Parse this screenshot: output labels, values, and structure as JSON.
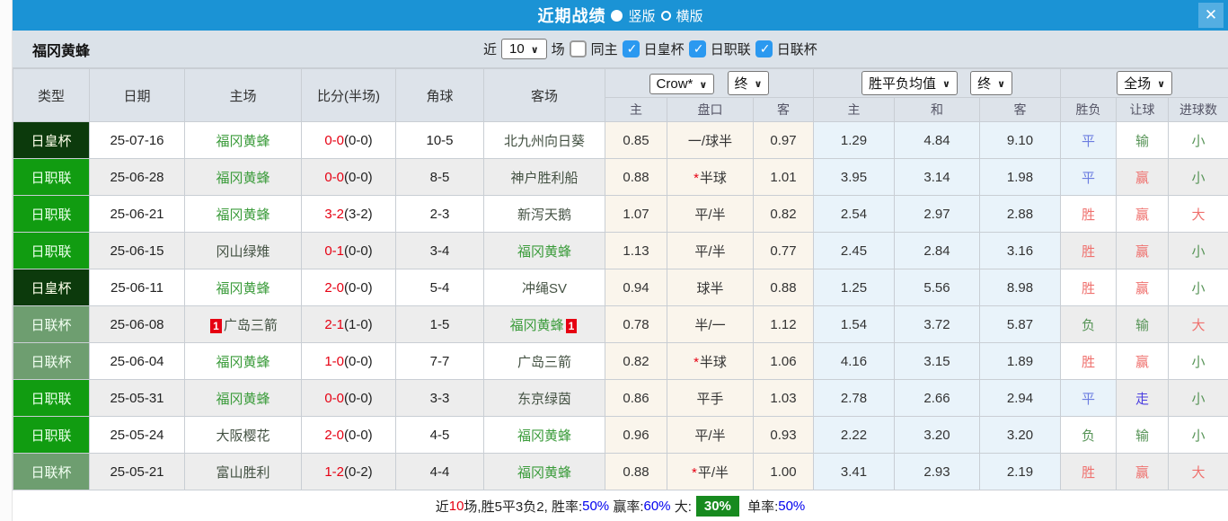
{
  "titlebar": {
    "title": "近期战绩",
    "vertical_label": "竖版",
    "horizontal_label": "横版",
    "vertical_selected": true,
    "close_icon": "✕"
  },
  "filter": {
    "team": "福冈黄蜂",
    "recent_label": "近",
    "count": "10",
    "matches_label": "场",
    "same_home_label": "同主",
    "same_home_checked": false,
    "leagues": [
      {
        "label": "日皇杯",
        "checked": true
      },
      {
        "label": "日职联",
        "checked": true
      },
      {
        "label": "日联杯",
        "checked": true
      }
    ]
  },
  "controls": {
    "bookmaker": "Crow*",
    "handicap_time": "终",
    "avg_label": "胜平负均值",
    "odds_time": "终",
    "scope": "全场"
  },
  "header": {
    "main": [
      "类型",
      "日期",
      "主场",
      "比分(半场)",
      "角球",
      "客场"
    ],
    "sub": [
      "主",
      "盘口",
      "客",
      "主",
      "和",
      "客",
      "胜负",
      "让球",
      "进球数"
    ]
  },
  "colors": {
    "titlebar_blue": "#1b93d5",
    "cup_green": "#0c3a0c",
    "league_green": "#119c11",
    "league_cup_green": "#6e9e70",
    "self_team_green": "#3a9b3a",
    "score_red": "#e60012",
    "result_red": "#ef716e",
    "result_blue": "#6b7ce0",
    "result_green": "#579457",
    "badge_green": "#178a1f"
  },
  "rows": [
    {
      "type": "日皇杯",
      "type_style": "cup",
      "date": "25-07-16",
      "home": "福冈黄蜂",
      "home_self": true,
      "home_card": "",
      "score": "0-0",
      "half": "(0-0)",
      "corner": "10-5",
      "away": "北九州向日葵",
      "away_self": false,
      "away_card": "",
      "h_home": "0.85",
      "h_star": false,
      "h_line": "一/球半",
      "h_away": "0.97",
      "o_home": "1.29",
      "o_draw": "4.84",
      "o_away": "9.10",
      "r_wdl": "平",
      "r_wdl_c": "blue",
      "r_handicap": "输",
      "r_handicap_c": "green",
      "r_goals": "小",
      "r_goals_c": "green"
    },
    {
      "type": "日职联",
      "type_style": "league",
      "date": "25-06-28",
      "home": "福冈黄蜂",
      "home_self": true,
      "home_card": "",
      "score": "0-0",
      "half": "(0-0)",
      "corner": "8-5",
      "away": "神户胜利船",
      "away_self": false,
      "away_card": "",
      "h_home": "0.88",
      "h_star": true,
      "h_line": "半球",
      "h_away": "1.01",
      "o_home": "3.95",
      "o_draw": "3.14",
      "o_away": "1.98",
      "r_wdl": "平",
      "r_wdl_c": "blue",
      "r_handicap": "赢",
      "r_handicap_c": "red",
      "r_goals": "小",
      "r_goals_c": "green"
    },
    {
      "type": "日职联",
      "type_style": "league",
      "date": "25-06-21",
      "home": "福冈黄蜂",
      "home_self": true,
      "home_card": "",
      "score": "3-2",
      "half": "(3-2)",
      "corner": "2-3",
      "away": "新泻天鹅",
      "away_self": false,
      "away_card": "",
      "h_home": "1.07",
      "h_star": false,
      "h_line": "平/半",
      "h_away": "0.82",
      "o_home": "2.54",
      "o_draw": "2.97",
      "o_away": "2.88",
      "r_wdl": "胜",
      "r_wdl_c": "red",
      "r_handicap": "赢",
      "r_handicap_c": "red",
      "r_goals": "大",
      "r_goals_c": "red"
    },
    {
      "type": "日职联",
      "type_style": "league",
      "date": "25-06-15",
      "home": "冈山绿雉",
      "home_self": false,
      "home_card": "",
      "score": "0-1",
      "half": "(0-0)",
      "corner": "3-4",
      "away": "福冈黄蜂",
      "away_self": true,
      "away_card": "",
      "h_home": "1.13",
      "h_star": false,
      "h_line": "平/半",
      "h_away": "0.77",
      "o_home": "2.45",
      "o_draw": "2.84",
      "o_away": "3.16",
      "r_wdl": "胜",
      "r_wdl_c": "red",
      "r_handicap": "赢",
      "r_handicap_c": "red",
      "r_goals": "小",
      "r_goals_c": "green"
    },
    {
      "type": "日皇杯",
      "type_style": "cup",
      "date": "25-06-11",
      "home": "福冈黄蜂",
      "home_self": true,
      "home_card": "",
      "score": "2-0",
      "half": "(0-0)",
      "corner": "5-4",
      "away": "冲绳SV",
      "away_self": false,
      "away_card": "",
      "h_home": "0.94",
      "h_star": false,
      "h_line": "球半",
      "h_away": "0.88",
      "o_home": "1.25",
      "o_draw": "5.56",
      "o_away": "8.98",
      "r_wdl": "胜",
      "r_wdl_c": "red",
      "r_handicap": "赢",
      "r_handicap_c": "red",
      "r_goals": "小",
      "r_goals_c": "green"
    },
    {
      "type": "日联杯",
      "type_style": "lcup",
      "date": "25-06-08",
      "home": "广岛三箭",
      "home_self": false,
      "home_card": "1",
      "score": "2-1",
      "half": "(1-0)",
      "corner": "1-5",
      "away": "福冈黄蜂",
      "away_self": true,
      "away_card": "1",
      "h_home": "0.78",
      "h_star": false,
      "h_line": "半/一",
      "h_away": "1.12",
      "o_home": "1.54",
      "o_draw": "3.72",
      "o_away": "5.87",
      "r_wdl": "负",
      "r_wdl_c": "green",
      "r_handicap": "输",
      "r_handicap_c": "green",
      "r_goals": "大",
      "r_goals_c": "red"
    },
    {
      "type": "日联杯",
      "type_style": "lcup",
      "date": "25-06-04",
      "home": "福冈黄蜂",
      "home_self": true,
      "home_card": "",
      "score": "1-0",
      "half": "(0-0)",
      "corner": "7-7",
      "away": "广岛三箭",
      "away_self": false,
      "away_card": "",
      "h_home": "0.82",
      "h_star": true,
      "h_line": "半球",
      "h_away": "1.06",
      "o_home": "4.16",
      "o_draw": "3.15",
      "o_away": "1.89",
      "r_wdl": "胜",
      "r_wdl_c": "red",
      "r_handicap": "赢",
      "r_handicap_c": "red",
      "r_goals": "小",
      "r_goals_c": "green"
    },
    {
      "type": "日职联",
      "type_style": "league",
      "date": "25-05-31",
      "home": "福冈黄蜂",
      "home_self": true,
      "home_card": "",
      "score": "0-0",
      "half": "(0-0)",
      "corner": "3-3",
      "away": "东京绿茵",
      "away_self": false,
      "away_card": "",
      "h_home": "0.86",
      "h_star": false,
      "h_line": "平手",
      "h_away": "1.03",
      "o_home": "2.78",
      "o_draw": "2.66",
      "o_away": "2.94",
      "r_wdl": "平",
      "r_wdl_c": "blue",
      "r_handicap": "走",
      "r_handicap_c": "indigo",
      "r_goals": "小",
      "r_goals_c": "green"
    },
    {
      "type": "日职联",
      "type_style": "league",
      "date": "25-05-24",
      "home": "大阪樱花",
      "home_self": false,
      "home_card": "",
      "score": "2-0",
      "half": "(0-0)",
      "corner": "4-5",
      "away": "福冈黄蜂",
      "away_self": true,
      "away_card": "",
      "h_home": "0.96",
      "h_star": false,
      "h_line": "平/半",
      "h_away": "0.93",
      "o_home": "2.22",
      "o_draw": "3.20",
      "o_away": "3.20",
      "r_wdl": "负",
      "r_wdl_c": "green",
      "r_handicap": "输",
      "r_handicap_c": "green",
      "r_goals": "小",
      "r_goals_c": "green"
    },
    {
      "type": "日联杯",
      "type_style": "lcup",
      "date": "25-05-21",
      "home": "富山胜利",
      "home_self": false,
      "home_card": "",
      "score": "1-2",
      "half": "(0-2)",
      "corner": "4-4",
      "away": "福冈黄蜂",
      "away_self": true,
      "away_card": "",
      "h_home": "0.88",
      "h_star": true,
      "h_line": "平/半",
      "h_away": "1.00",
      "o_home": "3.41",
      "o_draw": "2.93",
      "o_away": "2.19",
      "r_wdl": "胜",
      "r_wdl_c": "red",
      "r_handicap": "赢",
      "r_handicap_c": "red",
      "r_goals": "大",
      "r_goals_c": "red"
    }
  ],
  "footer": {
    "segments": [
      {
        "t": "近",
        "c": "black"
      },
      {
        "t": "10",
        "c": "red"
      },
      {
        "t": "场,胜5平3负2, 胜率:",
        "c": "black"
      },
      {
        "t": "50%",
        "c": "blue"
      },
      {
        "t": " 赢率:",
        "c": "black"
      },
      {
        "t": "60%",
        "c": "blue"
      },
      {
        "t": " 大:",
        "c": "black"
      },
      {
        "t": "30%",
        "c": "badge"
      },
      {
        "t": " 单率:",
        "c": "black"
      },
      {
        "t": "50%",
        "c": "blue"
      }
    ]
  }
}
